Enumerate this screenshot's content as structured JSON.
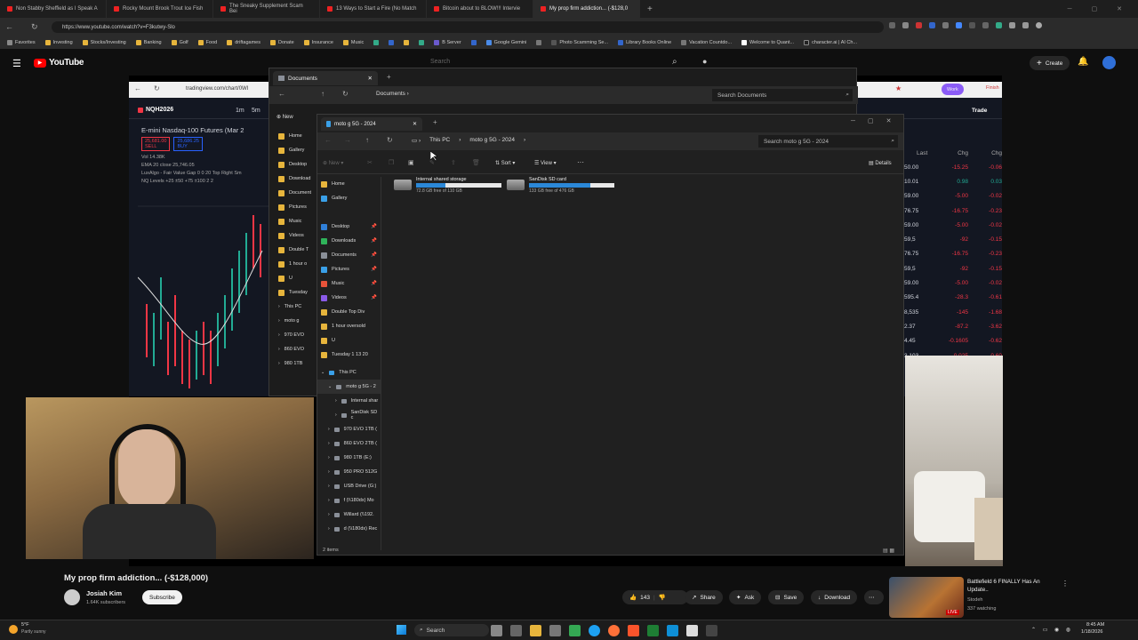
{
  "browser": {
    "tabs": [
      {
        "label": "Non Stabby Sheffield as I Speak A"
      },
      {
        "label": "Rocky Mount Brook Trout Ice Fish"
      },
      {
        "label": "The Sneaky Supplement Scam Bei"
      },
      {
        "label": "13 Ways to Start a Fire (No Match"
      },
      {
        "label": "Bitcoin about to BLOW!!! Intervie"
      },
      {
        "label": "My prop firm addiction... (-$128,0"
      }
    ],
    "url": "https://www.youtube.com/watch?v=F3kutwy-Slo",
    "bookmarks": [
      "Favorites",
      "Investing",
      "Stocks/Investing",
      "Banking",
      "Golf",
      "Food",
      "driftagames",
      "Donate",
      "Insurance",
      "Music",
      "",
      "",
      "",
      "",
      "B Server",
      "",
      "Google Gemini",
      "",
      "Photo Scamming Se...",
      "Library Books Online",
      "Vacation Countdo...",
      "Welcome to Quant...",
      "character.ai | AI Ch..."
    ]
  },
  "youtube": {
    "logo": "YouTube",
    "search_placeholder": "Search",
    "create_label": "Create",
    "video_title": "My prop firm addiction... (-$128,000)",
    "channel": "Josiah Kim",
    "subscribers": "1.64K subscribers",
    "subscribe_label": "Subscribe",
    "likes": "143",
    "share": "Share",
    "ask": "Ask",
    "save": "Save",
    "download": "Download",
    "rec_title": "Battlefield 6 FINALLY Has An Update..",
    "rec_channel": "Stodeh",
    "rec_watching": "337 watching",
    "live": "LIVE"
  },
  "trading": {
    "url": "tradingview.com/chart/0WI",
    "symbol": "NQH2026",
    "intervals": [
      "1m",
      "5m"
    ],
    "title": "E-mini Nasdaq-100 Futures (Mar 2",
    "sell": "25,681.00",
    "sell_label": "SELL",
    "buy": "25,686.25",
    "buy_label": "BUY",
    "vol": "Vol 14.38K",
    "ema": "EMA 20 close  25,746.05",
    "lux": "LuxAlgo - Fair Value Gap 0 0 20 Top Right Sm",
    "nq": "NQ Levels +25 ±50 +75 ±100 2 2",
    "trade": "Trade",
    "work": "Work",
    "finish": "Finish",
    "watch_headers": [
      "Last",
      "Chg",
      "Chg"
    ],
    "watch_rows": [
      {
        "last": "50.00",
        "chg": "-15.25",
        "pct": "-0.06",
        "color": "#f23645"
      },
      {
        "last": "10.01",
        "chg": "0.98",
        "pct": "0.03",
        "color": "#22ab94"
      },
      {
        "last": "59.00",
        "chg": "-5.00",
        "pct": "-0.02",
        "color": "#f23645"
      },
      {
        "last": "76.75",
        "chg": "-16.75",
        "pct": "-0.23",
        "color": "#f23645"
      },
      {
        "last": "59.00",
        "chg": "-5.00",
        "pct": "-0.02",
        "color": "#f23645"
      },
      {
        "last": "59,5",
        "chg": "-92",
        "pct": "-0.15",
        "color": "#f23645"
      },
      {
        "last": "76.75",
        "chg": "-16.75",
        "pct": "-0.23",
        "color": "#f23645"
      },
      {
        "last": "59,5",
        "chg": "-92",
        "pct": "-0.15",
        "color": "#f23645"
      },
      {
        "last": "59.00",
        "chg": "-5.00",
        "pct": "-0.02",
        "color": "#f23645"
      },
      {
        "last": "595.4",
        "chg": "-28.3",
        "pct": "-0.61",
        "color": "#f23645"
      },
      {
        "last": "8,535",
        "chg": "-145",
        "pct": "-1.68",
        "color": "#f23645"
      },
      {
        "last": "2.37",
        "chg": "-87.2",
        "pct": "-3.62",
        "color": "#f23645"
      },
      {
        "last": "4.45",
        "chg": "-0.1605",
        "pct": "-0.62",
        "color": "#f23645"
      },
      {
        "last": "3.103",
        "chg": "-0.025",
        "pct": "-0.60",
        "color": "#f23645"
      }
    ]
  },
  "explorer_back": {
    "tab": "Documents",
    "crumb": "Documents",
    "search": "Search Documents",
    "new_label": "New",
    "nav": [
      "Home",
      "Gallery",
      "Desktop",
      "Download",
      "Document",
      "Pictures",
      "Music",
      "Videos",
      "Double T",
      "1 hour o",
      "U",
      "Tuesday"
    ],
    "tree": [
      "This PC",
      "moto g",
      "970 EVO",
      "860 EVO",
      "980 1TB"
    ]
  },
  "explorer": {
    "tab": "moto g 5G - 2024",
    "crumbs": [
      "This PC",
      "moto g 5G - 2024"
    ],
    "search": "Search moto g 5G - 2024",
    "toolbar": {
      "new": "New",
      "sort": "Sort",
      "view": "View",
      "details": "Details"
    },
    "nav": [
      {
        "label": "Home",
        "color": "#e7b53c"
      },
      {
        "label": "Gallery",
        "color": "#3aa0e8"
      },
      {
        "label": "Desktop",
        "color": "#2f7fd8"
      },
      {
        "label": "Downloads",
        "color": "#2fb35a"
      },
      {
        "label": "Documents",
        "color": "#8a8f98"
      },
      {
        "label": "Pictures",
        "color": "#3aa0e8"
      },
      {
        "label": "Music",
        "color": "#e8533a"
      },
      {
        "label": "Videos",
        "color": "#8a5ae8"
      },
      {
        "label": "Double Top Div",
        "color": "#e7b53c"
      },
      {
        "label": "1 hour oversold",
        "color": "#e7b53c"
      },
      {
        "label": "U",
        "color": "#e7b53c"
      },
      {
        "label": "Tuesday 1 13 20",
        "color": "#e7b53c"
      }
    ],
    "tree": [
      "This PC",
      "moto g 5G - 2",
      "Internal shar",
      "SanDisk SD c",
      "970 EVO 1TB (",
      "860 EVO 2TB (",
      "980 1TB (E:)",
      "950 PRO 512G",
      "USB Drive (G:)",
      "f (\\\\180dx) Mo",
      "Willard (\\\\192.",
      "d (\\\\180dx) Rec"
    ],
    "drives": [
      {
        "name": "Internal shared storage",
        "free": "72.8 GB free of 110 GB",
        "used": 0.34
      },
      {
        "name": "SanDisk SD card",
        "free": "133 GB free of 476 GB",
        "used": 0.72
      }
    ],
    "status": "2 items"
  },
  "taskbar": {
    "weather_temp": "5°F",
    "weather_desc": "Partly sunny",
    "search": "Search",
    "time": "8:45 AM",
    "date": "1/18/2026"
  }
}
